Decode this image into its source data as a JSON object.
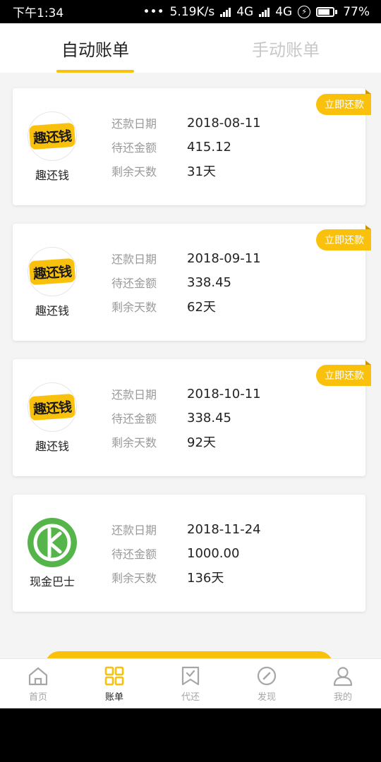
{
  "status_bar": {
    "time": "下午1:34",
    "dots": "•••",
    "net_speed": "5.19K/s",
    "network1": "4G",
    "network2": "4G",
    "battery": "77%"
  },
  "tabs": [
    {
      "label": "自动账单",
      "active": true
    },
    {
      "label": "手动账单",
      "active": false
    }
  ],
  "bills": [
    {
      "logo_text": "趣还钱",
      "name": "趣还钱",
      "tag": "立即还款",
      "date_label": "还款日期",
      "date": "2018-08-11",
      "amount_label": "待还金额",
      "amount": "415.12",
      "days_label": "剩余天数",
      "days": "31天"
    },
    {
      "logo_text": "趣还钱",
      "name": "趣还钱",
      "tag": "立即还款",
      "date_label": "还款日期",
      "date": "2018-09-11",
      "amount_label": "待还金额",
      "amount": "338.45",
      "days_label": "剩余天数",
      "days": "62天"
    },
    {
      "logo_text": "趣还钱",
      "name": "趣还钱",
      "tag": "立即还款",
      "date_label": "还款日期",
      "date": "2018-10-11",
      "amount_label": "待还金额",
      "amount": "338.45",
      "days_label": "剩余天数",
      "days": "92天"
    },
    {
      "logo_text": "",
      "name": "现金巴士",
      "tag": "",
      "date_label": "还款日期",
      "date": "2018-11-24",
      "amount_label": "待还金额",
      "amount": "1000.00",
      "days_label": "剩余天数",
      "days": "136天"
    }
  ],
  "nav": [
    {
      "label": "首页",
      "icon": "home-icon",
      "active": false
    },
    {
      "label": "账单",
      "icon": "grid-icon",
      "active": true
    },
    {
      "label": "代还",
      "icon": "bookmark-check-icon",
      "active": false
    },
    {
      "label": "发现",
      "icon": "compass-icon",
      "active": false
    },
    {
      "label": "我的",
      "icon": "user-icon",
      "active": false
    }
  ],
  "colors": {
    "accent": "#f9c10c",
    "inactive": "#a6a6a6",
    "logo_green": "#55b44a"
  }
}
